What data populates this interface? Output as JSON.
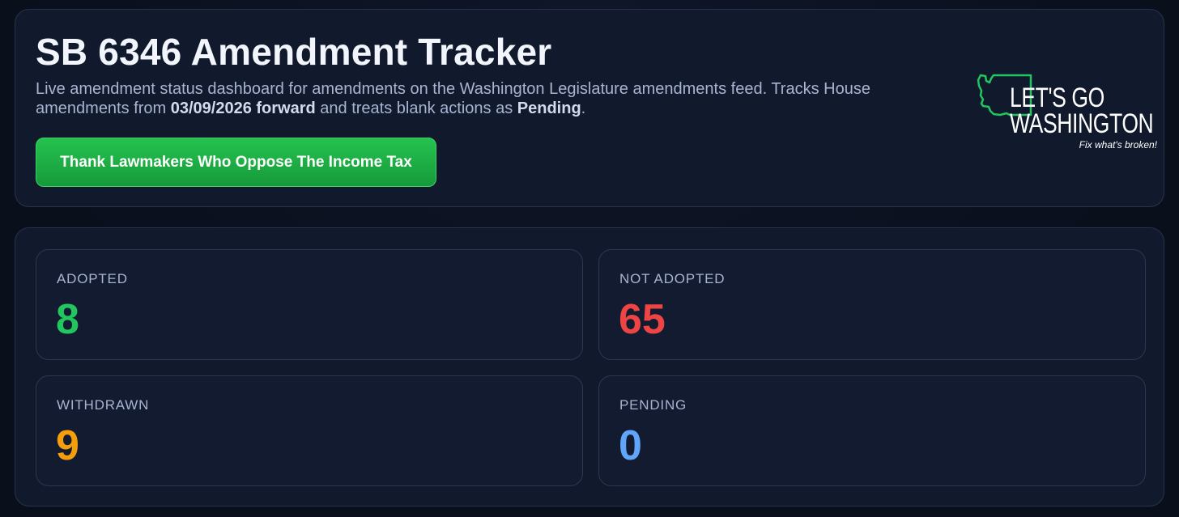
{
  "header": {
    "title": "SB 6346 Amendment Tracker",
    "desc_1": "Live amendment status dashboard for amendments on the Washington Legislature amendments feed. Tracks House amendments from ",
    "desc_bold_1": "03/09/2026 forward",
    "desc_2": " and treats blank actions as ",
    "desc_bold_2": "Pending",
    "desc_3": ".",
    "cta_label": "Thank Lawmakers Who Oppose The Income Tax"
  },
  "logo": {
    "line1": "LET'S GO",
    "line2": "WASHINGTON",
    "tagline": "Fix what's broken!",
    "icon": "washington-state-outline-icon",
    "outline_color": "#22c55e"
  },
  "stats": [
    {
      "label": "ADOPTED",
      "value": "8",
      "color": "#22c55e"
    },
    {
      "label": "NOT ADOPTED",
      "value": "65",
      "color": "#ef4444"
    },
    {
      "label": "WITHDRAWN",
      "value": "9",
      "color": "#f59e0b"
    },
    {
      "label": "PENDING",
      "value": "0",
      "color": "#60a5fa"
    }
  ]
}
